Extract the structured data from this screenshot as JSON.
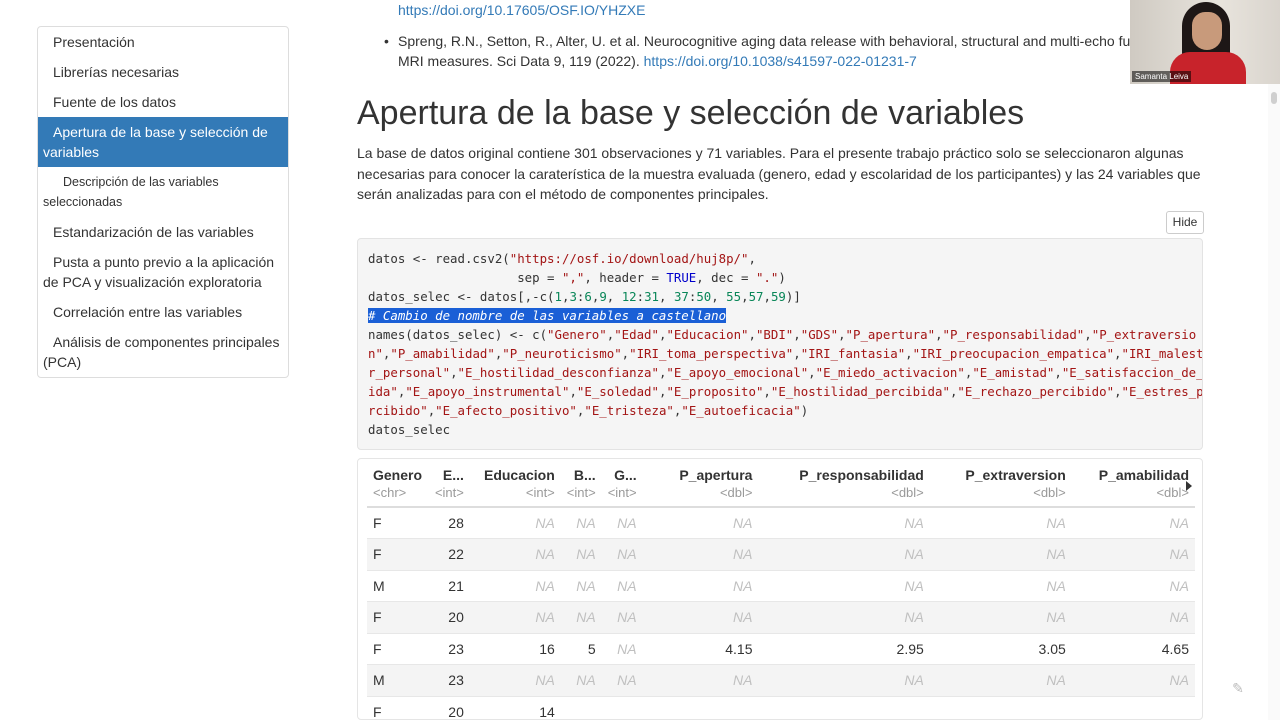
{
  "toc": {
    "items": [
      {
        "label": "Presentación"
      },
      {
        "label": "Librerías necesarias"
      },
      {
        "label": "Fuente de los datos"
      },
      {
        "label": "Apertura de la base y selección de variables"
      },
      {
        "label": "Descripción de las variables seleccionadas"
      },
      {
        "label": "Estandarización de las variables"
      },
      {
        "label": "Pusta a punto previo a la aplicación de PCA y visualización exploratoria"
      },
      {
        "label": "Correlación entre las variables"
      },
      {
        "label": "Análisis de componentes principales (PCA)"
      }
    ]
  },
  "refs": {
    "doi1": "https://doi.org/10.17605/OSF.IO/YHZXE",
    "ref2_text": "Spreng, R.N., Setton, R., Alter, U. et al. Neurocognitive aging data release with behavioral, structural and multi-echo functional MRI measures. Sci Data 9, 119 (2022). ",
    "doi2": "https://doi.org/10.1038/s41597-022-01231-7"
  },
  "section": {
    "title": "Apertura de la base y selección de variables",
    "intro": "La base de datos original contiene 301 observaciones y 71 variables. Para el presente trabajo práctico solo se seleccionaron algunas necesarias para conocer la caraterística de la muestra evaluada (genero, edad y escolaridad de los participantes) y las 24 variables que serán analizadas para con el método de componentes principales.",
    "hide_label": "Hide"
  },
  "table": {
    "columns": [
      {
        "name": "Genero",
        "type": "<chr>"
      },
      {
        "name": "E...",
        "type": "<int>"
      },
      {
        "name": "Educacion",
        "type": "<int>"
      },
      {
        "name": "B...",
        "type": "<int>"
      },
      {
        "name": "G...",
        "type": "<int>"
      },
      {
        "name": "P_apertura",
        "type": "<dbl>"
      },
      {
        "name": "P_responsabilidad",
        "type": "<dbl>"
      },
      {
        "name": "P_extraversion",
        "type": "<dbl>"
      },
      {
        "name": "P_amabilidad",
        "type": "<dbl>"
      }
    ],
    "rows": [
      [
        "F",
        "28",
        "NA",
        "NA",
        "NA",
        "NA",
        "NA",
        "NA",
        "NA"
      ],
      [
        "F",
        "22",
        "NA",
        "NA",
        "NA",
        "NA",
        "NA",
        "NA",
        "NA"
      ],
      [
        "M",
        "21",
        "NA",
        "NA",
        "NA",
        "NA",
        "NA",
        "NA",
        "NA"
      ],
      [
        "F",
        "20",
        "NA",
        "NA",
        "NA",
        "NA",
        "NA",
        "NA",
        "NA"
      ],
      [
        "F",
        "23",
        "16",
        "5",
        "NA",
        "4.15",
        "2.95",
        "3.05",
        "4.65"
      ],
      [
        "M",
        "23",
        "NA",
        "NA",
        "NA",
        "NA",
        "NA",
        "NA",
        "NA"
      ],
      [
        "F",
        "20",
        "14",
        "",
        "",
        "",
        "",
        "",
        ""
      ]
    ]
  },
  "webcam": {
    "name": "Samanta Leiva"
  }
}
